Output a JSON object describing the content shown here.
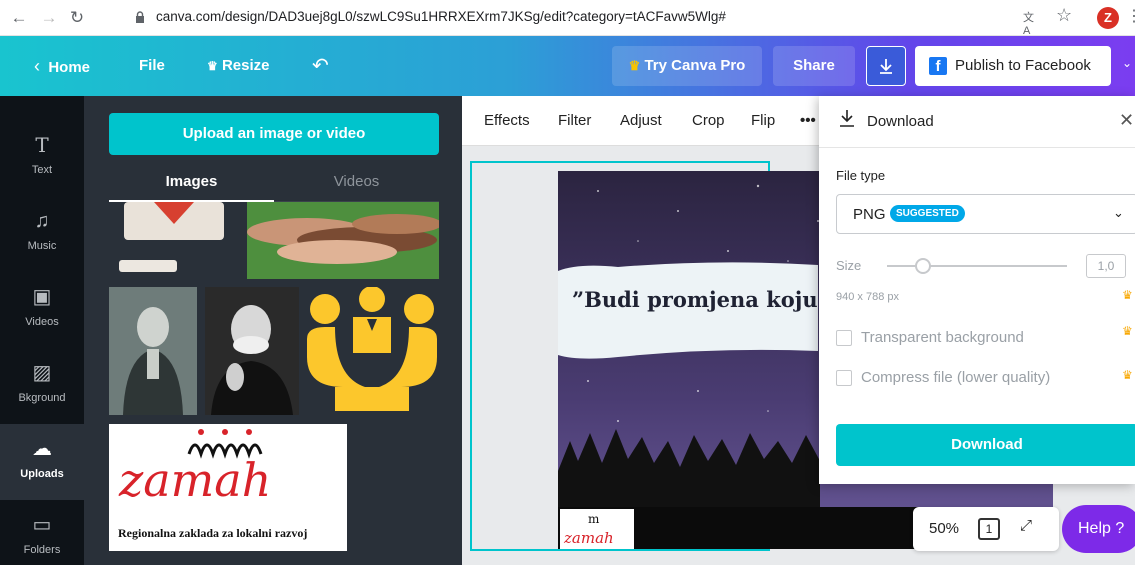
{
  "browser": {
    "url": "canva.com/design/DAD3uej8gL0/szwLC9Su1HRRXEXrm7JKSg/edit?category=tACFavw5Wlg#",
    "avatar_initial": "Z"
  },
  "topbar": {
    "home": "Home",
    "file": "File",
    "resize": "Resize",
    "try_pro": "Try Canva Pro",
    "share": "Share",
    "publish": "Publish to Facebook"
  },
  "rail": [
    {
      "label": "Text",
      "icon": "text-icon"
    },
    {
      "label": "Music",
      "icon": "music-icon"
    },
    {
      "label": "Videos",
      "icon": "video-icon"
    },
    {
      "label": "Bkground",
      "icon": "background-icon"
    },
    {
      "label": "Uploads",
      "icon": "upload-icon"
    },
    {
      "label": "Folders",
      "icon": "folder-icon"
    }
  ],
  "panel": {
    "upload_button": "Upload an image or video",
    "tab_images": "Images",
    "tab_videos": "Videos",
    "logo_text": "Regionalna zaklada za lokalni razvoj",
    "logo_word": "zamah"
  },
  "toolbar": {
    "effects": "Effects",
    "filter": "Filter",
    "adjust": "Adjust",
    "crop": "Crop",
    "flip": "Flip",
    "more": "•••"
  },
  "design": {
    "quote": "”Budi promjena koju že"
  },
  "zoom": {
    "value": "50%",
    "page": "1"
  },
  "help": "Help ?",
  "download": {
    "title": "Download",
    "file_type_label": "File type",
    "file_type": "PNG",
    "badge": "SUGGESTED",
    "size_label": "Size",
    "size_value": "1,0",
    "size_level": 0.2,
    "dimensions": "940 x 788 px",
    "transparent": "Transparent background",
    "compress": "Compress file (lower quality)",
    "button": "Download"
  },
  "colors": {
    "accent": "#00c4cc",
    "rail_bg": "#0e1318",
    "panel_bg": "#293039",
    "help": "#7d2ae8"
  }
}
